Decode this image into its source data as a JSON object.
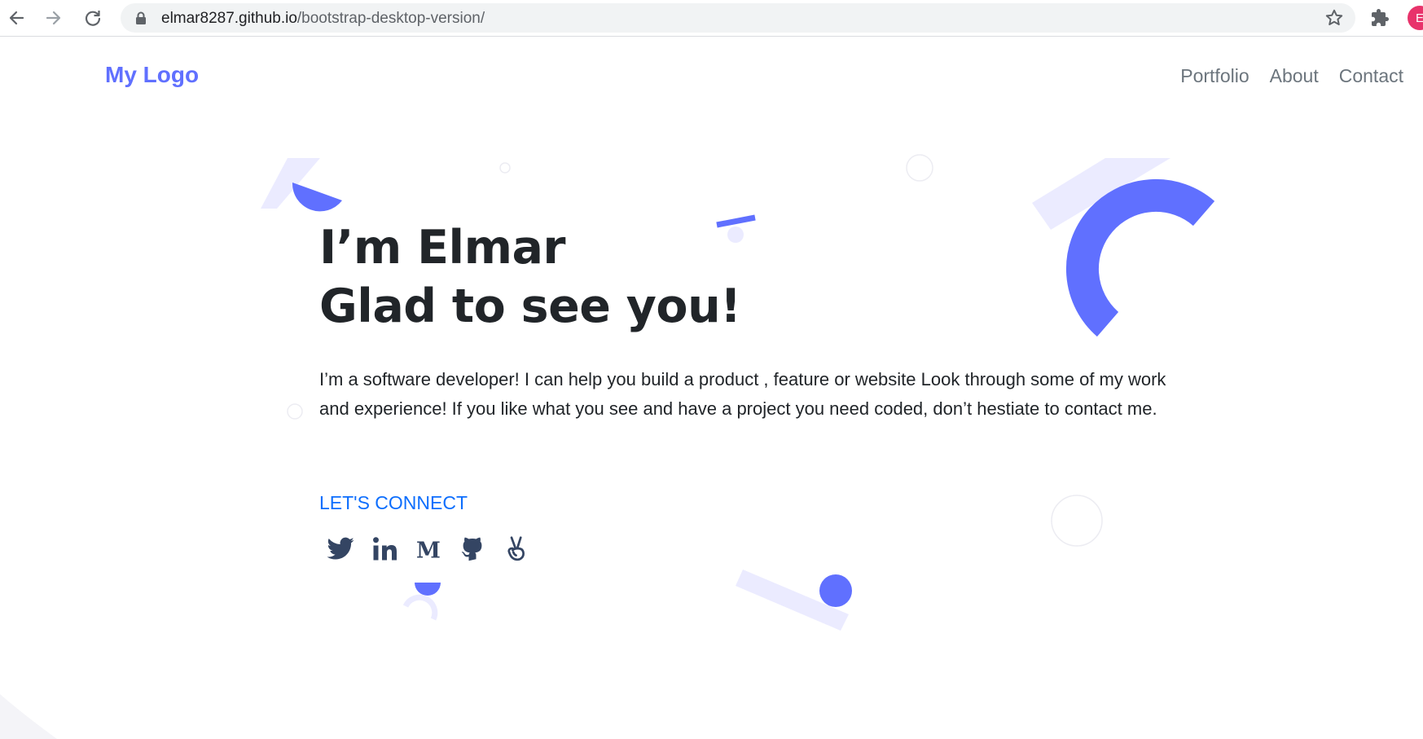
{
  "browser": {
    "url_domain": "elmar8287.github.io",
    "url_path": "/bootstrap-desktop-version/",
    "profile_initial": "E",
    "icons": [
      "back-icon",
      "forward-icon",
      "reload-icon",
      "lock-icon",
      "star-icon",
      "extensions-icon"
    ]
  },
  "header": {
    "logo": "My Logo",
    "nav": [
      "Portfolio",
      "About",
      "Contact"
    ]
  },
  "hero": {
    "title_line1": "I’m Elmar",
    "title_line2": "Glad to see you!",
    "text": "I’m a software developer! I can help you build a product , feature or website Look through some of my work and experience! If you like what you see and have a project you need coded, don’t hestiate to contact me.",
    "connect": "LET'S CONNECT",
    "social_icons": [
      "twitter-icon",
      "linkedin-icon",
      "medium-icon",
      "github-icon",
      "angellist-icon"
    ]
  },
  "colors": {
    "accent": "#6070ff",
    "accent_light": "#ebebff",
    "link": "#0d6efd",
    "text": "#212529",
    "nav": "#6c757d",
    "social": "#344563",
    "avatar": "#e8336b"
  }
}
